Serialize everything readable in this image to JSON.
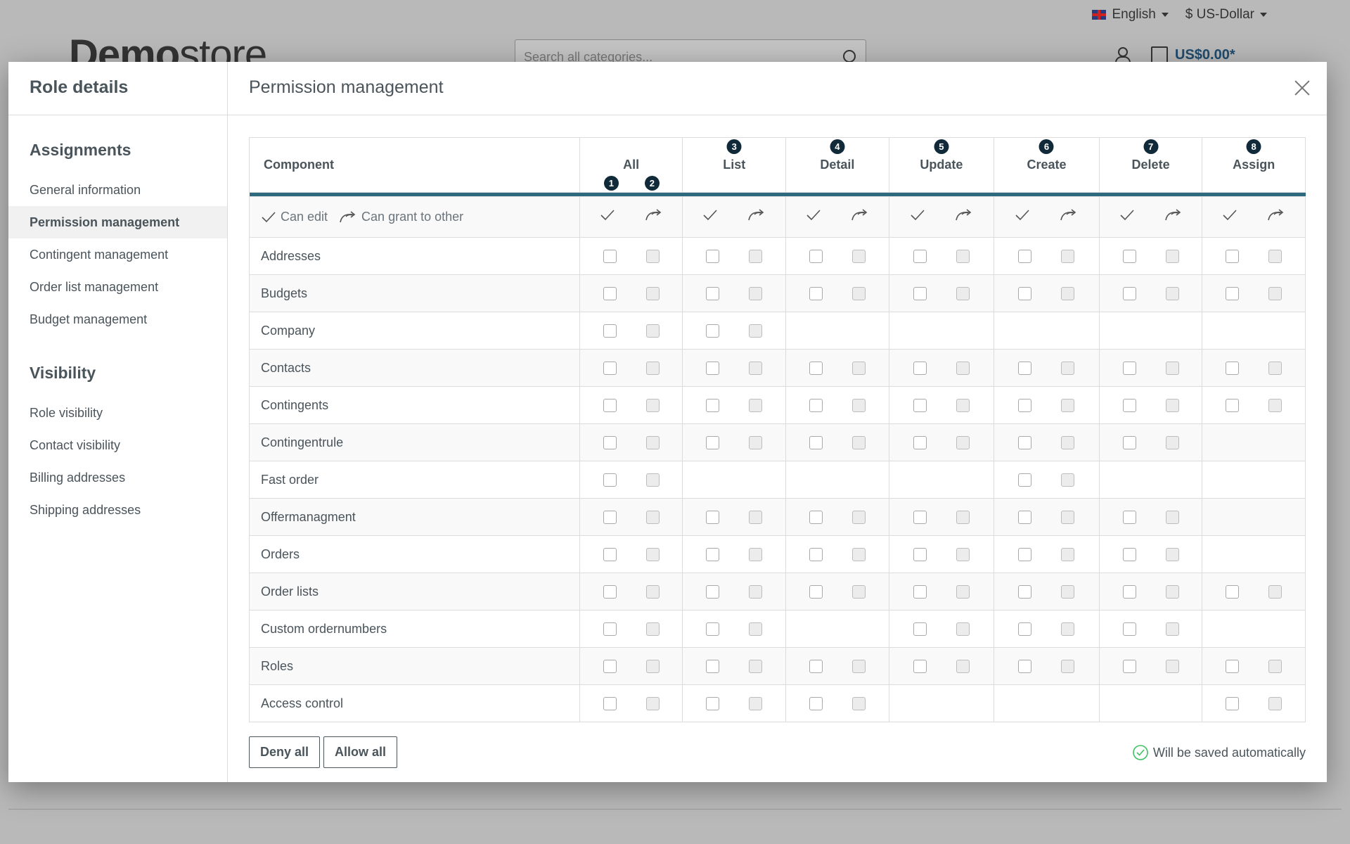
{
  "store": {
    "language": "English",
    "currency": "$ US-Dollar",
    "logo_bold": "Demo",
    "logo_light": "store",
    "search_placeholder": "Search all categories...",
    "cart_total": "US$0.00*"
  },
  "sidebar": {
    "title": "Role details",
    "section1": "Assignments",
    "items1": [
      "General information",
      "Permission management",
      "Contingent management",
      "Order list management",
      "Budget management"
    ],
    "section2": "Visibility",
    "items2": [
      "Role visibility",
      "Contact visibility",
      "Billing addresses",
      "Shipping addresses"
    ]
  },
  "main": {
    "title": "Permission management",
    "component_header": "Component",
    "columns": [
      {
        "label": "All",
        "badge": ""
      },
      {
        "label": "List",
        "badge": "3"
      },
      {
        "label": "Detail",
        "badge": "4"
      },
      {
        "label": "Update",
        "badge": "5"
      },
      {
        "label": "Create",
        "badge": "6"
      },
      {
        "label": "Delete",
        "badge": "7"
      },
      {
        "label": "Assign",
        "badge": "8"
      }
    ],
    "all_badge_1": "1",
    "all_badge_2": "2",
    "legend_edit": "Can edit",
    "legend_grant": "Can grant to other",
    "rows": [
      {
        "name": "Addresses",
        "cols": [
          1,
          1,
          1,
          1,
          1,
          1,
          1
        ]
      },
      {
        "name": "Budgets",
        "cols": [
          1,
          1,
          1,
          1,
          1,
          1,
          1
        ]
      },
      {
        "name": "Company",
        "cols": [
          1,
          1,
          0,
          0,
          0,
          0,
          0
        ]
      },
      {
        "name": "Contacts",
        "cols": [
          1,
          1,
          1,
          1,
          1,
          1,
          1
        ]
      },
      {
        "name": "Contingents",
        "cols": [
          1,
          1,
          1,
          1,
          1,
          1,
          1
        ]
      },
      {
        "name": "Contingentrule",
        "cols": [
          1,
          1,
          1,
          1,
          1,
          1,
          0
        ]
      },
      {
        "name": "Fast order",
        "cols": [
          1,
          0,
          0,
          0,
          1,
          0,
          0
        ]
      },
      {
        "name": "Offermanagment",
        "cols": [
          1,
          1,
          1,
          1,
          1,
          1,
          0
        ]
      },
      {
        "name": "Orders",
        "cols": [
          1,
          1,
          1,
          1,
          1,
          1,
          0
        ]
      },
      {
        "name": "Order lists",
        "cols": [
          1,
          1,
          1,
          1,
          1,
          1,
          1
        ]
      },
      {
        "name": "Custom ordernumbers",
        "cols": [
          1,
          1,
          0,
          1,
          1,
          1,
          0
        ]
      },
      {
        "name": "Roles",
        "cols": [
          1,
          1,
          1,
          1,
          1,
          1,
          1
        ]
      },
      {
        "name": "Access control",
        "cols": [
          1,
          1,
          1,
          0,
          0,
          0,
          1
        ]
      }
    ],
    "deny_all": "Deny all",
    "allow_all": "Allow all",
    "autosave": "Will be saved automatically"
  },
  "colors": {
    "accent_bar": "#2e6a7e",
    "badge": "#102a3a",
    "success": "#3cc261"
  }
}
